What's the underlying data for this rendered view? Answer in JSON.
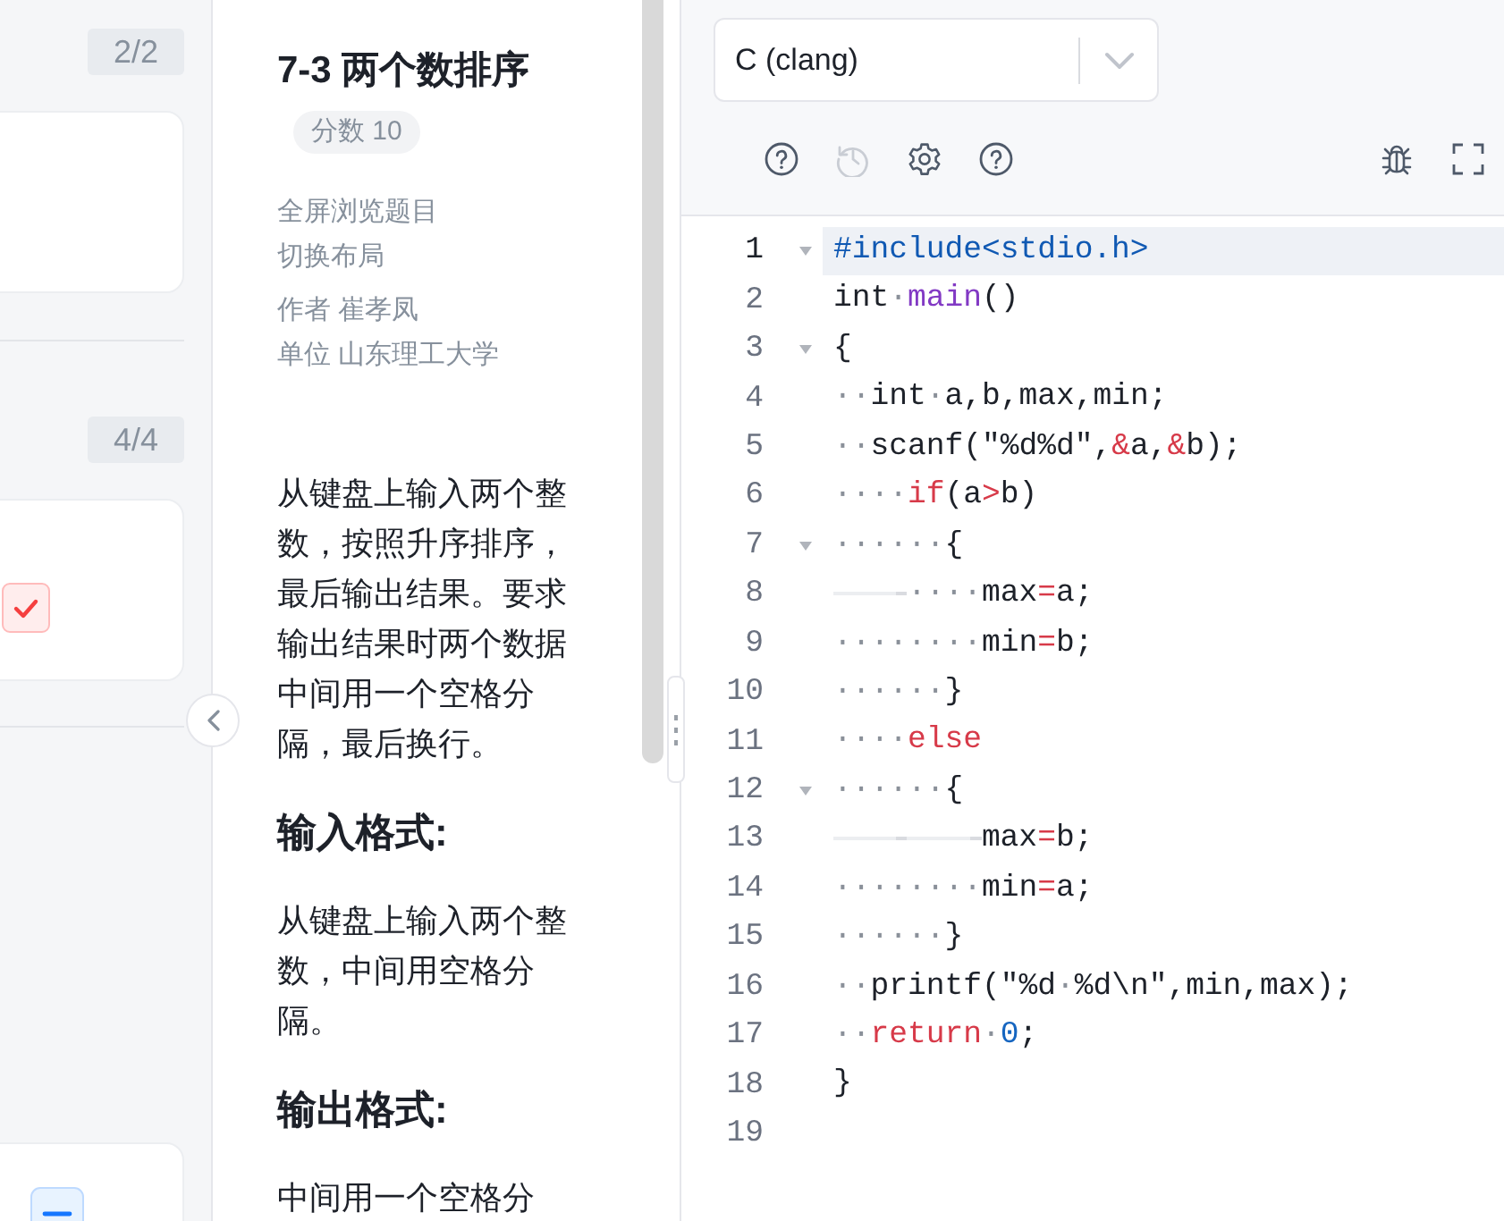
{
  "question_groups": [
    {
      "count": "2/2",
      "cards": [
        {
          "kind": "plain"
        }
      ]
    },
    {
      "count": "4/4",
      "cards": [
        {
          "kind": "check"
        }
      ]
    },
    {
      "cards": [
        {
          "kind": "minus"
        }
      ]
    }
  ],
  "problem": {
    "title": "7-3 两个数排序",
    "score": "分数 10",
    "links": [
      "全屏浏览题目",
      "切换布局"
    ],
    "meta": [
      "作者 崔孝凤",
      "单位 山东理工大学"
    ],
    "description": "从键盘上输入两个整数，按照升序排序，最后输出结果。要求输出结果时两个数据中间用一个空格分隔，最后换行。",
    "sections": [
      {
        "heading": "输入格式:",
        "text": "从键盘上输入两个整数，中间用空格分隔。"
      },
      {
        "heading": "输出格式:",
        "text": "中间用一个空格分"
      }
    ]
  },
  "editor": {
    "language": "C (clang)",
    "tools": [
      {
        "kind": "help",
        "disabled": false
      },
      {
        "kind": "history",
        "disabled": true
      },
      {
        "kind": "settings",
        "disabled": false
      },
      {
        "kind": "help",
        "disabled": false
      }
    ],
    "right_tools": [
      {
        "kind": "bug"
      },
      {
        "kind": "fullscreen"
      }
    ],
    "lines": [
      {
        "number": "1",
        "fold": true,
        "active": true,
        "tokens": [
          {
            "kind": "preproc",
            "text": "#include<stdio.h>"
          }
        ]
      },
      {
        "number": "2",
        "fold": false,
        "active": false,
        "tokens": [
          {
            "kind": "text",
            "text": "int"
          },
          {
            "kind": "space",
            "text": "·"
          },
          {
            "kind": "function",
            "text": "main"
          },
          {
            "kind": "text",
            "text": "()"
          }
        ]
      },
      {
        "number": "3",
        "fold": true,
        "active": false,
        "tokens": [
          {
            "kind": "text",
            "text": "{"
          }
        ]
      },
      {
        "number": "4",
        "fold": false,
        "active": false,
        "tokens": [
          {
            "kind": "space",
            "text": "··"
          },
          {
            "kind": "text",
            "text": "int"
          },
          {
            "kind": "space",
            "text": "·"
          },
          {
            "kind": "text",
            "text": "a,b,max,min;"
          }
        ]
      },
      {
        "number": "5",
        "fold": false,
        "active": false,
        "tokens": [
          {
            "kind": "space",
            "text": "··"
          },
          {
            "kind": "text",
            "text": "scanf(\"%d%d\","
          },
          {
            "kind": "operator",
            "text": "&"
          },
          {
            "kind": "text",
            "text": "a,"
          },
          {
            "kind": "operator",
            "text": "&"
          },
          {
            "kind": "text",
            "text": "b);"
          }
        ]
      },
      {
        "number": "6",
        "fold": false,
        "active": false,
        "tokens": [
          {
            "kind": "space",
            "text": "····"
          },
          {
            "kind": "keyword",
            "text": "if"
          },
          {
            "kind": "text",
            "text": "(a"
          },
          {
            "kind": "operator",
            "text": ">"
          },
          {
            "kind": "text",
            "text": "b)"
          }
        ]
      },
      {
        "number": "7",
        "fold": true,
        "active": false,
        "tokens": [
          {
            "kind": "space",
            "text": "······"
          },
          {
            "kind": "text",
            "text": "{"
          }
        ]
      },
      {
        "number": "8",
        "fold": false,
        "active": false,
        "tokens": [
          {
            "kind": "tab"
          },
          {
            "kind": "space",
            "text": "····"
          },
          {
            "kind": "text",
            "text": "max"
          },
          {
            "kind": "operator",
            "text": "="
          },
          {
            "kind": "text",
            "text": "a;"
          }
        ]
      },
      {
        "number": "9",
        "fold": false,
        "active": false,
        "tokens": [
          {
            "kind": "space",
            "text": "········"
          },
          {
            "kind": "text",
            "text": "min"
          },
          {
            "kind": "operator",
            "text": "="
          },
          {
            "kind": "text",
            "text": "b;"
          }
        ]
      },
      {
        "number": "10",
        "fold": false,
        "active": false,
        "tokens": [
          {
            "kind": "space",
            "text": "······"
          },
          {
            "kind": "text",
            "text": "}"
          }
        ]
      },
      {
        "number": "11",
        "fold": false,
        "active": false,
        "tokens": [
          {
            "kind": "space",
            "text": "····"
          },
          {
            "kind": "keyword",
            "text": "else"
          }
        ]
      },
      {
        "number": "12",
        "fold": true,
        "active": false,
        "tokens": [
          {
            "kind": "space",
            "text": "······"
          },
          {
            "kind": "text",
            "text": "{"
          }
        ]
      },
      {
        "number": "13",
        "fold": false,
        "active": false,
        "tokens": [
          {
            "kind": "tab"
          },
          {
            "kind": "tab"
          },
          {
            "kind": "text",
            "text": "max"
          },
          {
            "kind": "operator",
            "text": "="
          },
          {
            "kind": "text",
            "text": "b;"
          }
        ]
      },
      {
        "number": "14",
        "fold": false,
        "active": false,
        "tokens": [
          {
            "kind": "space",
            "text": "········"
          },
          {
            "kind": "text",
            "text": "min"
          },
          {
            "kind": "operator",
            "text": "="
          },
          {
            "kind": "text",
            "text": "a;"
          }
        ]
      },
      {
        "number": "15",
        "fold": false,
        "active": false,
        "tokens": [
          {
            "kind": "space",
            "text": "······"
          },
          {
            "kind": "text",
            "text": "}"
          }
        ]
      },
      {
        "number": "16",
        "fold": false,
        "active": false,
        "tokens": [
          {
            "kind": "space",
            "text": "··"
          },
          {
            "kind": "text",
            "text": "printf(\"%d"
          },
          {
            "kind": "space",
            "text": "·"
          },
          {
            "kind": "text",
            "text": "%d\\n\",min,max);"
          }
        ]
      },
      {
        "number": "17",
        "fold": false,
        "active": false,
        "tokens": [
          {
            "kind": "space",
            "text": "··"
          },
          {
            "kind": "keyword",
            "text": "return"
          },
          {
            "kind": "space",
            "text": "·"
          },
          {
            "kind": "number",
            "text": "0"
          },
          {
            "kind": "text",
            "text": ";"
          }
        ]
      },
      {
        "number": "18",
        "fold": false,
        "active": false,
        "tokens": [
          {
            "kind": "text",
            "text": "}"
          }
        ]
      },
      {
        "number": "19",
        "fold": false,
        "active": false
      }
    ]
  }
}
